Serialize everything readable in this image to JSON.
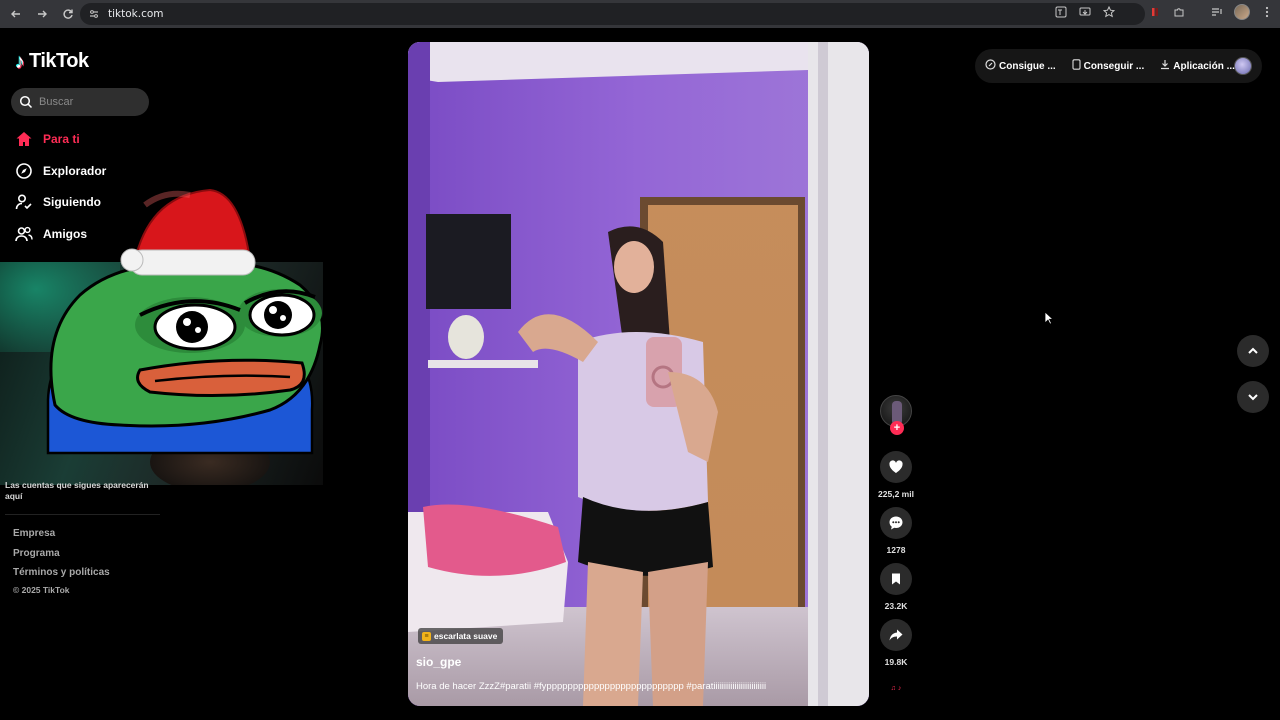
{
  "browser": {
    "url": "tiktok.com",
    "back_icon": "arrow-left-icon",
    "forward_icon": "arrow-right-icon",
    "reload_icon": "reload-icon"
  },
  "sidebar": {
    "logo_text": "TikTok",
    "search_placeholder": "Buscar",
    "items": [
      {
        "label": "Para ti",
        "icon": "home-icon",
        "active": true
      },
      {
        "label": "Explorador",
        "icon": "compass-icon",
        "active": false
      },
      {
        "label": "Siguiendo",
        "icon": "following-icon",
        "active": false
      },
      {
        "label": "Amigos",
        "icon": "friends-icon",
        "active": false
      }
    ],
    "following_note": "Las cuentas que sigues aparecerán aquí",
    "footer": {
      "links": [
        "Empresa",
        "Programa",
        "Términos y políticas"
      ],
      "copyright": "© 2025 TikTok"
    }
  },
  "video": {
    "sound_tag": "escarlata suave",
    "author": "sio_gpe",
    "caption": "Hora de hacer ZzzZ#paratii #fypppppppppppppppppppppppppp #paratiiiiiiiiiiiiiiiiiiiiiiiii"
  },
  "actions": {
    "likes": "225,2 mil",
    "comments": "1278",
    "saves": "23.2K",
    "shares": "19.8K"
  },
  "topbar": {
    "items": [
      {
        "label": "Consigue ...",
        "icon": "coin-icon"
      },
      {
        "label": "Conseguir ...",
        "icon": "phone-icon"
      },
      {
        "label": "Aplicación ...",
        "icon": "download-icon"
      }
    ]
  },
  "colors": {
    "accent": "#fe2c55",
    "background": "#000000",
    "wall": "#8a5fcf"
  }
}
